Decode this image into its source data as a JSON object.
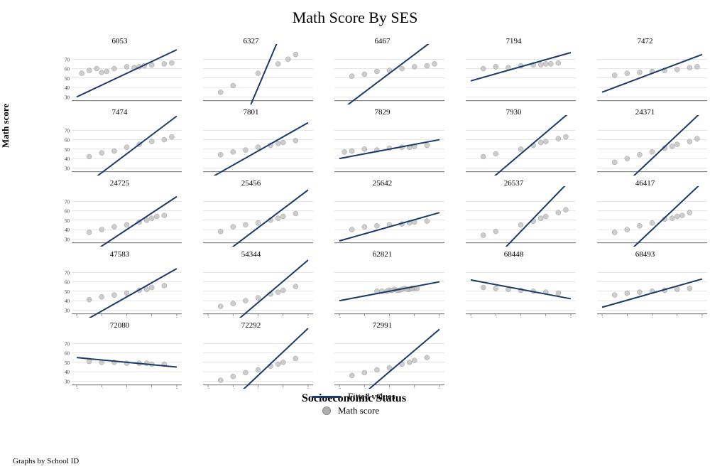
{
  "title": "Math Score By SES",
  "x_axis_label": "Socioeconomic Status",
  "y_axis_label": "Math score",
  "graphs_by_label": "Graphs by School ID",
  "legend": {
    "fitted_label": "Fitted values",
    "math_score_label": "Math score"
  },
  "y_ticks": [
    "70",
    "60",
    "50",
    "40",
    "30"
  ],
  "x_ticks": [
    "-2",
    "-1",
    "0",
    "1",
    "2"
  ],
  "cells": [
    {
      "id": "6053",
      "slope": 0.5,
      "intercept": 0.55,
      "dots": [
        [
          -1.8,
          0.55
        ],
        [
          -1.5,
          0.58
        ],
        [
          -1.2,
          0.6
        ],
        [
          -0.8,
          0.57
        ],
        [
          -0.5,
          0.6
        ],
        [
          0,
          0.62
        ],
        [
          0.3,
          0.61
        ],
        [
          0.7,
          0.63
        ],
        [
          1.0,
          0.64
        ],
        [
          1.5,
          0.65
        ],
        [
          1.8,
          0.66
        ],
        [
          -1.0,
          0.56
        ],
        [
          0.5,
          0.62
        ]
      ]
    },
    {
      "id": "6327",
      "slope": 2.5,
      "intercept": 0.4,
      "dots": [
        [
          -1.5,
          0.35
        ],
        [
          -1.0,
          0.42
        ],
        [
          0,
          0.55
        ],
        [
          0.8,
          0.65
        ],
        [
          1.2,
          0.7
        ],
        [
          1.5,
          0.75
        ]
      ]
    },
    {
      "id": "6467",
      "slope": 0.8,
      "intercept": 0.55,
      "dots": [
        [
          -1.5,
          0.52
        ],
        [
          -1.0,
          0.54
        ],
        [
          0,
          0.58
        ],
        [
          0.5,
          0.6
        ],
        [
          1.0,
          0.62
        ],
        [
          1.5,
          0.63
        ],
        [
          1.8,
          0.65
        ],
        [
          -0.5,
          0.57
        ]
      ]
    },
    {
      "id": "7194",
      "slope": 0.3,
      "intercept": 0.62,
      "dots": [
        [
          -1.5,
          0.6
        ],
        [
          -1.0,
          0.62
        ],
        [
          0,
          0.63
        ],
        [
          0.5,
          0.64
        ],
        [
          1.0,
          0.65
        ],
        [
          1.5,
          0.66
        ],
        [
          -0.5,
          0.61
        ],
        [
          0.8,
          0.64
        ],
        [
          1.2,
          0.65
        ]
      ]
    },
    {
      "id": "7472",
      "slope": 0.4,
      "intercept": 0.55,
      "dots": [
        [
          -1.5,
          0.53
        ],
        [
          -1.0,
          0.55
        ],
        [
          0,
          0.57
        ],
        [
          0.5,
          0.58
        ],
        [
          1.0,
          0.59
        ],
        [
          1.5,
          0.61
        ],
        [
          1.8,
          0.62
        ],
        [
          -0.5,
          0.56
        ]
      ]
    },
    {
      "id": "7474",
      "slope": 0.8,
      "intercept": 0.45,
      "dots": [
        [
          -1.5,
          0.42
        ],
        [
          -1.0,
          0.46
        ],
        [
          -0.5,
          0.48
        ],
        [
          0,
          0.52
        ],
        [
          0.5,
          0.55
        ],
        [
          1.0,
          0.58
        ],
        [
          1.5,
          0.6
        ],
        [
          1.8,
          0.63
        ]
      ]
    },
    {
      "id": "7801",
      "slope": 0.6,
      "intercept": 0.48,
      "dots": [
        [
          -1.5,
          0.44
        ],
        [
          -1.0,
          0.47
        ],
        [
          0,
          0.52
        ],
        [
          0.5,
          0.54
        ],
        [
          1.0,
          0.57
        ],
        [
          1.5,
          0.59
        ],
        [
          -0.5,
          0.49
        ],
        [
          0.8,
          0.56
        ]
      ]
    },
    {
      "id": "7829",
      "slope": 0.2,
      "intercept": 0.5,
      "dots": [
        [
          -1.5,
          0.48
        ],
        [
          -1.0,
          0.5
        ],
        [
          0,
          0.51
        ],
        [
          0.5,
          0.52
        ],
        [
          1.0,
          0.53
        ],
        [
          1.5,
          0.54
        ],
        [
          -0.5,
          0.49
        ],
        [
          0.8,
          0.52
        ],
        [
          -1.8,
          0.47
        ]
      ]
    },
    {
      "id": "7930",
      "slope": 0.9,
      "intercept": 0.45,
      "dots": [
        [
          -1.5,
          0.42
        ],
        [
          -1.0,
          0.45
        ],
        [
          0,
          0.5
        ],
        [
          0.5,
          0.54
        ],
        [
          1.0,
          0.58
        ],
        [
          1.5,
          0.61
        ],
        [
          1.8,
          0.63
        ],
        [
          0.8,
          0.57
        ]
      ]
    },
    {
      "id": "24371",
      "slope": 1.0,
      "intercept": 0.4,
      "dots": [
        [
          -1.5,
          0.36
        ],
        [
          -1.0,
          0.4
        ],
        [
          0,
          0.47
        ],
        [
          0.5,
          0.51
        ],
        [
          1.0,
          0.55
        ],
        [
          1.5,
          0.58
        ],
        [
          1.8,
          0.61
        ],
        [
          -0.5,
          0.44
        ],
        [
          0.8,
          0.53
        ]
      ]
    },
    {
      "id": "24725",
      "slope": 0.7,
      "intercept": 0.4,
      "dots": [
        [
          -1.5,
          0.37
        ],
        [
          -1.0,
          0.4
        ],
        [
          0,
          0.45
        ],
        [
          0.5,
          0.48
        ],
        [
          1.0,
          0.52
        ],
        [
          1.5,
          0.55
        ],
        [
          -0.5,
          0.43
        ],
        [
          0.8,
          0.5
        ],
        [
          1.2,
          0.54
        ]
      ]
    },
    {
      "id": "25456",
      "slope": 0.8,
      "intercept": 0.42,
      "dots": [
        [
          -1.5,
          0.38
        ],
        [
          -1.0,
          0.43
        ],
        [
          0,
          0.47
        ],
        [
          0.5,
          0.5
        ],
        [
          1.0,
          0.54
        ],
        [
          1.5,
          0.57
        ],
        [
          -0.5,
          0.45
        ],
        [
          0.8,
          0.52
        ]
      ]
    },
    {
      "id": "25642",
      "slope": 0.3,
      "intercept": 0.43,
      "dots": [
        [
          -1.5,
          0.4
        ],
        [
          -1.0,
          0.43
        ],
        [
          0,
          0.45
        ],
        [
          0.5,
          0.46
        ],
        [
          1.0,
          0.48
        ],
        [
          1.5,
          0.49
        ],
        [
          -0.5,
          0.44
        ],
        [
          0.8,
          0.47
        ]
      ]
    },
    {
      "id": "26537",
      "slope": 1.1,
      "intercept": 0.38,
      "dots": [
        [
          -1.5,
          0.34
        ],
        [
          -1.0,
          0.38
        ],
        [
          0,
          0.45
        ],
        [
          0.5,
          0.49
        ],
        [
          1.0,
          0.54
        ],
        [
          1.5,
          0.58
        ],
        [
          1.8,
          0.61
        ],
        [
          0.8,
          0.52
        ]
      ]
    },
    {
      "id": "46417",
      "slope": 1.0,
      "intercept": 0.4,
      "dots": [
        [
          -1.5,
          0.37
        ],
        [
          -1.0,
          0.4
        ],
        [
          0,
          0.47
        ],
        [
          0.5,
          0.51
        ],
        [
          1.0,
          0.54
        ],
        [
          1.5,
          0.58
        ],
        [
          -0.5,
          0.44
        ],
        [
          0.8,
          0.52
        ],
        [
          1.2,
          0.55
        ]
      ]
    },
    {
      "id": "47583",
      "slope": 0.6,
      "intercept": 0.44,
      "dots": [
        [
          -1.5,
          0.41
        ],
        [
          -1.0,
          0.44
        ],
        [
          0,
          0.48
        ],
        [
          0.5,
          0.51
        ],
        [
          1.0,
          0.54
        ],
        [
          1.5,
          0.56
        ],
        [
          -0.5,
          0.46
        ],
        [
          0.8,
          0.52
        ]
      ]
    },
    {
      "id": "54344",
      "slope": 0.9,
      "intercept": 0.38,
      "dots": [
        [
          -1.5,
          0.34
        ],
        [
          -1.0,
          0.37
        ],
        [
          0,
          0.43
        ],
        [
          0.5,
          0.47
        ],
        [
          1.0,
          0.51
        ],
        [
          1.5,
          0.55
        ],
        [
          -0.5,
          0.4
        ],
        [
          0.8,
          0.49
        ]
      ]
    },
    {
      "id": "62821",
      "slope": 0.2,
      "intercept": 0.5,
      "dots": [
        [
          -0.5,
          0.5
        ],
        [
          0,
          0.51
        ],
        [
          0.2,
          0.52
        ],
        [
          0.4,
          0.51
        ],
        [
          0.6,
          0.53
        ],
        [
          0.8,
          0.52
        ],
        [
          1.0,
          0.53
        ],
        [
          -0.3,
          0.5
        ],
        [
          0.3,
          0.51
        ],
        [
          0.5,
          0.52
        ],
        [
          0.7,
          0.52
        ],
        [
          0.9,
          0.53
        ],
        [
          1.1,
          0.53
        ],
        [
          0.1,
          0.51
        ],
        [
          -0.1,
          0.5
        ]
      ]
    },
    {
      "id": "68448",
      "slope": -0.2,
      "intercept": 0.52,
      "dots": [
        [
          -1.5,
          0.54
        ],
        [
          -1.0,
          0.53
        ],
        [
          0,
          0.51
        ],
        [
          0.5,
          0.5
        ],
        [
          1.0,
          0.49
        ],
        [
          1.5,
          0.48
        ],
        [
          -0.5,
          0.52
        ]
      ]
    },
    {
      "id": "68493",
      "slope": 0.3,
      "intercept": 0.48,
      "dots": [
        [
          -1.5,
          0.46
        ],
        [
          -1.0,
          0.48
        ],
        [
          0,
          0.5
        ],
        [
          0.5,
          0.51
        ],
        [
          1.0,
          0.52
        ],
        [
          1.5,
          0.53
        ],
        [
          -0.5,
          0.49
        ]
      ]
    },
    {
      "id": "72080",
      "slope": -0.1,
      "intercept": 0.5,
      "dots": [
        [
          -1.5,
          0.51
        ],
        [
          -1.0,
          0.5
        ],
        [
          0,
          0.49
        ],
        [
          0.5,
          0.49
        ],
        [
          1.0,
          0.48
        ],
        [
          1.5,
          0.48
        ],
        [
          -0.5,
          0.5
        ],
        [
          0.8,
          0.49
        ]
      ]
    },
    {
      "id": "72292",
      "slope": 1.0,
      "intercept": 0.36,
      "dots": [
        [
          -1.5,
          0.31
        ],
        [
          -1.0,
          0.35
        ],
        [
          0,
          0.42
        ],
        [
          0.5,
          0.46
        ],
        [
          1.0,
          0.5
        ],
        [
          1.5,
          0.54
        ],
        [
          -0.5,
          0.39
        ],
        [
          0.8,
          0.48
        ]
      ]
    },
    {
      "id": "72991",
      "slope": 0.9,
      "intercept": 0.4,
      "dots": [
        [
          -1.5,
          0.36
        ],
        [
          -1.0,
          0.39
        ],
        [
          0,
          0.44
        ],
        [
          0.5,
          0.48
        ],
        [
          1.0,
          0.52
        ],
        [
          1.5,
          0.55
        ],
        [
          -0.5,
          0.42
        ],
        [
          0.8,
          0.5
        ]
      ]
    }
  ]
}
